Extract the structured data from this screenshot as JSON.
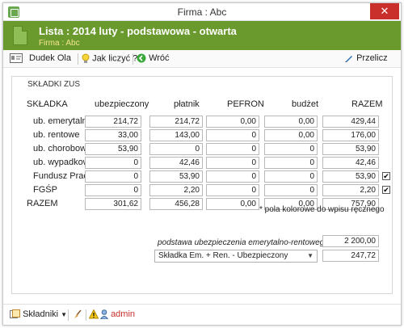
{
  "window": {
    "title": "Firma : Abc",
    "close_glyph": "✕"
  },
  "banner": {
    "title": "Lista : 2014 luty - podstawowa - otwarta",
    "subtitle": "Firma : Abc"
  },
  "toolbar": {
    "user": "Dudek Ola",
    "howto": "Jak liczyć ?",
    "back": "Wróć",
    "recalc": "Przelicz"
  },
  "section_title": "SKŁADKI ZUS",
  "table": {
    "headers": [
      "SKŁADKA",
      "ubezpieczony",
      "płatnik",
      "PEFRON",
      "budżet",
      "RAZEM"
    ],
    "rows": [
      {
        "label": "ub. emerytalne",
        "values": [
          "214,72",
          "214,72",
          "0,00",
          "0,00",
          "429,44"
        ],
        "checked": null
      },
      {
        "label": "ub. rentowe",
        "values": [
          "33,00",
          "143,00",
          "0",
          "0,00",
          "176,00"
        ],
        "checked": null
      },
      {
        "label": "ub. chorobowe",
        "values": [
          "53,90",
          "0",
          "0",
          "0",
          "53,90"
        ],
        "checked": null
      },
      {
        "label": "ub. wypadkowe",
        "values": [
          "0",
          "42,46",
          "0",
          "0",
          "42,46"
        ],
        "checked": null
      },
      {
        "label": "Fundusz Pracy",
        "values": [
          "0",
          "53,90",
          "0",
          "0",
          "53,90"
        ],
        "checked": "✔"
      },
      {
        "label": "FGŚP",
        "values": [
          "0",
          "2,20",
          "0",
          "0",
          "2,20"
        ],
        "checked": "✔"
      }
    ],
    "total": {
      "label": "RAZEM",
      "values": [
        "301,62",
        "456,28",
        "0,00",
        "0,00",
        "757,90"
      ]
    }
  },
  "note": "* pola kolorowe do wpisu ręcznego",
  "basis": {
    "label": "podstawa ubezpieczenia emerytalno-rentowego",
    "value": "2 200,00"
  },
  "selector": {
    "selected": "Składka Em. + Ren. - Ubezpieczony",
    "value": "247,72"
  },
  "status": {
    "components": "Składniki",
    "admin": "admin"
  },
  "colors": {
    "banner": "#6a9a2e",
    "accent": "#f4e58c",
    "close": "#c9302c"
  }
}
